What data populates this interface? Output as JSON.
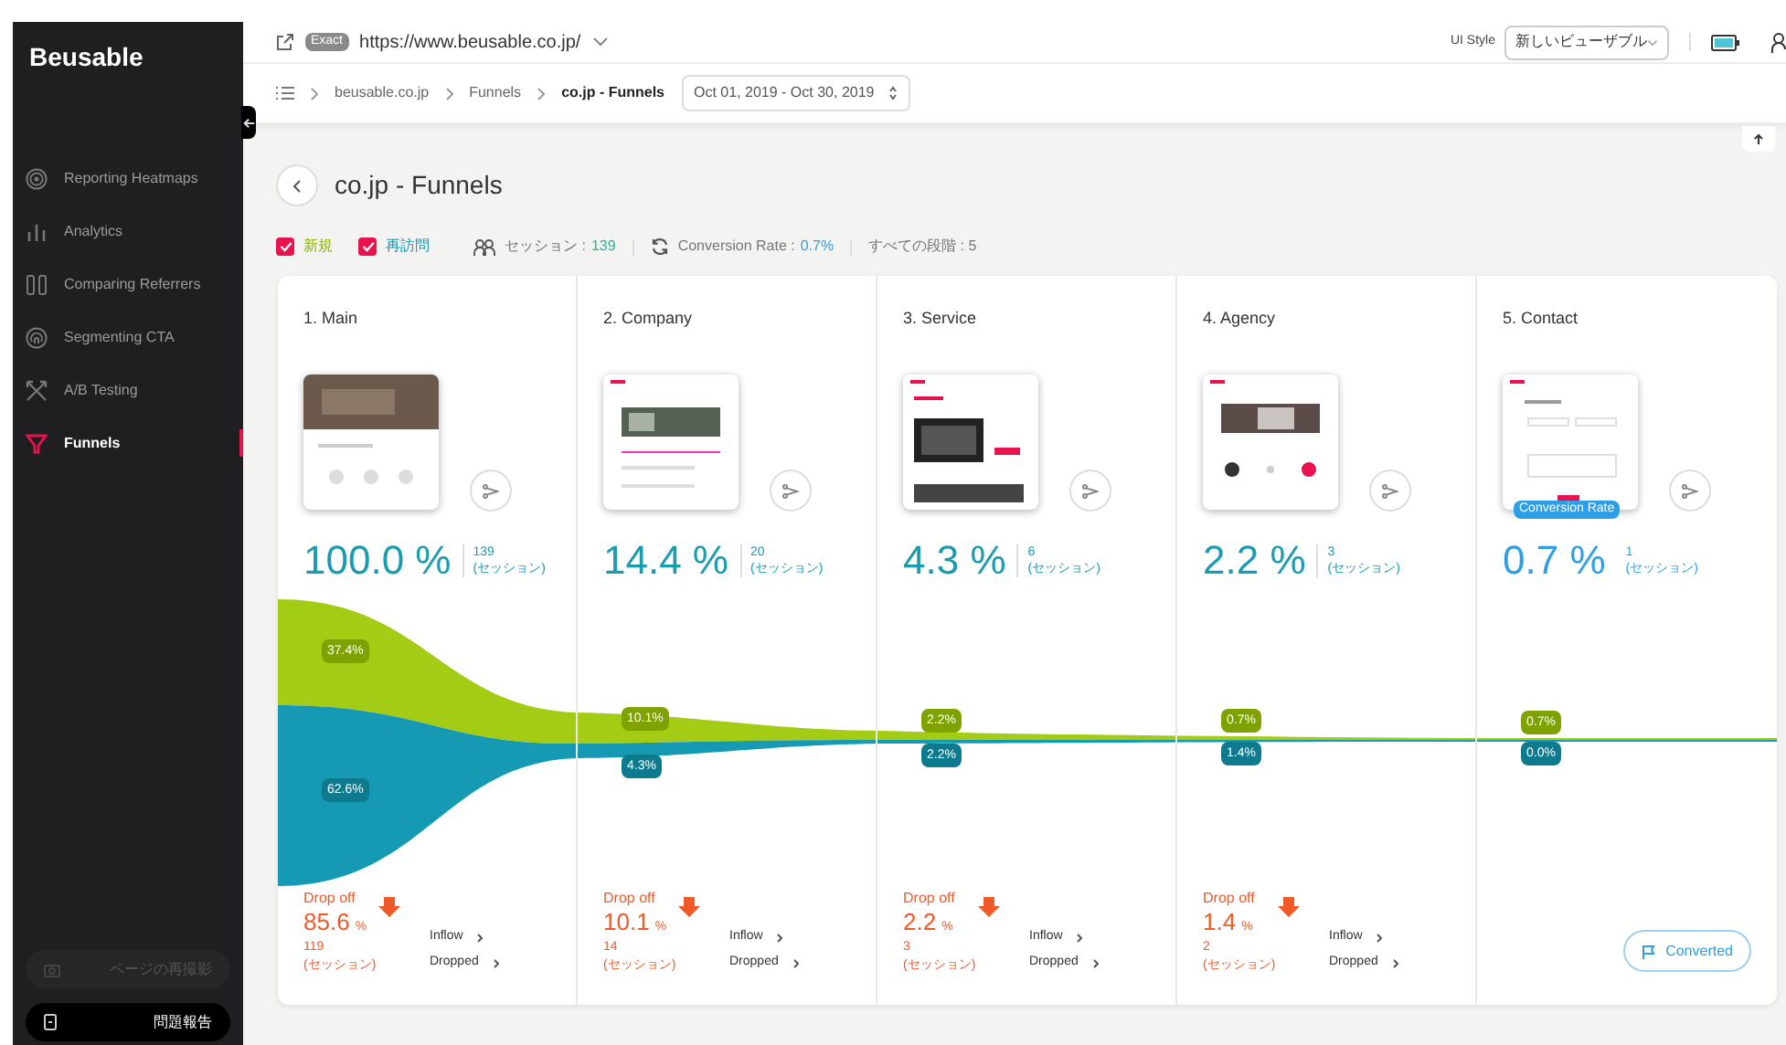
{
  "brand": "Beusable",
  "sidebar": {
    "items": [
      {
        "label": "Reporting Heatmaps",
        "selected": false
      },
      {
        "label": "Analytics",
        "selected": false
      },
      {
        "label": "Comparing Referrers",
        "selected": false
      },
      {
        "label": "Segmenting CTA",
        "selected": false
      },
      {
        "label": "A/B Testing",
        "selected": false
      },
      {
        "label": "Funnels",
        "selected": true
      }
    ],
    "bottom_buttons": [
      {
        "label": "ページの再撮影",
        "disabled": true
      },
      {
        "label": "問題報告",
        "disabled": false
      }
    ]
  },
  "url_bar": {
    "badge": "Exact",
    "url": "https://www.beusable.co.jp/",
    "ui_style_label": "UI Style",
    "ui_style_value": "新しいビューザブル"
  },
  "breadcrumb": [
    {
      "label": "beusable.co.jp",
      "current": false
    },
    {
      "label": "Funnels",
      "current": false
    },
    {
      "label": "co.jp - Funnels",
      "current": true
    }
  ],
  "date_range": "Oct 01, 2019 - Oct 30, 2019",
  "page_title": "co.jp - Funnels",
  "filters": [
    {
      "label": "新規",
      "checked": true,
      "color": "#8db600"
    },
    {
      "label": "再訪問",
      "checked": true,
      "color": "#1597b0"
    }
  ],
  "summary": {
    "sessions_label": "セッション :",
    "sessions_value": "139",
    "conversion_label": "Conversion Rate :",
    "conversion_value": "0.7%",
    "stages": "すべての段階 : 5"
  },
  "steps": [
    {
      "kind": "step",
      "title": "1. Main",
      "percent": "100.0 %",
      "sessions": "139",
      "sessions_unit": "(セッション)",
      "new_share": "37.4%",
      "returning_share": "62.6%",
      "drop_label": "Drop off",
      "drop_percent": "85.6",
      "drop_unit": "%",
      "drop_sessions": "119",
      "drop_sessions_unit": "(セッション)",
      "inflow": "Inflow",
      "dropped": "Dropped"
    },
    {
      "kind": "step",
      "title": "2. Company",
      "percent": "14.4 %",
      "sessions": "20",
      "sessions_unit": "(セッション)",
      "new_share": "10.1%",
      "returning_share": "4.3%",
      "drop_label": "Drop off",
      "drop_percent": "10.1",
      "drop_unit": "%",
      "drop_sessions": "14",
      "drop_sessions_unit": "(セッション)",
      "inflow": "Inflow",
      "dropped": "Dropped"
    },
    {
      "kind": "step",
      "title": "3. Service",
      "percent": "4.3 %",
      "sessions": "6",
      "sessions_unit": "(セッション)",
      "new_share": "2.2%",
      "returning_share": "2.2%",
      "drop_label": "Drop off",
      "drop_percent": "2.2",
      "drop_unit": "%",
      "drop_sessions": "3",
      "drop_sessions_unit": "(セッション)",
      "inflow": "Inflow",
      "dropped": "Dropped"
    },
    {
      "kind": "step",
      "title": "4. Agency",
      "percent": "2.2 %",
      "sessions": "3",
      "sessions_unit": "(セッション)",
      "new_share": "0.7%",
      "returning_share": "1.4%",
      "drop_label": "Drop off",
      "drop_percent": "1.4",
      "drop_unit": "%",
      "drop_sessions": "2",
      "drop_sessions_unit": "(セッション)",
      "inflow": "Inflow",
      "dropped": "Dropped"
    },
    {
      "kind": "goal",
      "title": "5. Contact",
      "badge": "Conversion Rate",
      "percent": "0.7 %",
      "sessions": "1",
      "sessions_unit": "(セッション)",
      "new_share": "0.7%",
      "returning_share": "0.0%",
      "converted": "Converted"
    }
  ]
}
